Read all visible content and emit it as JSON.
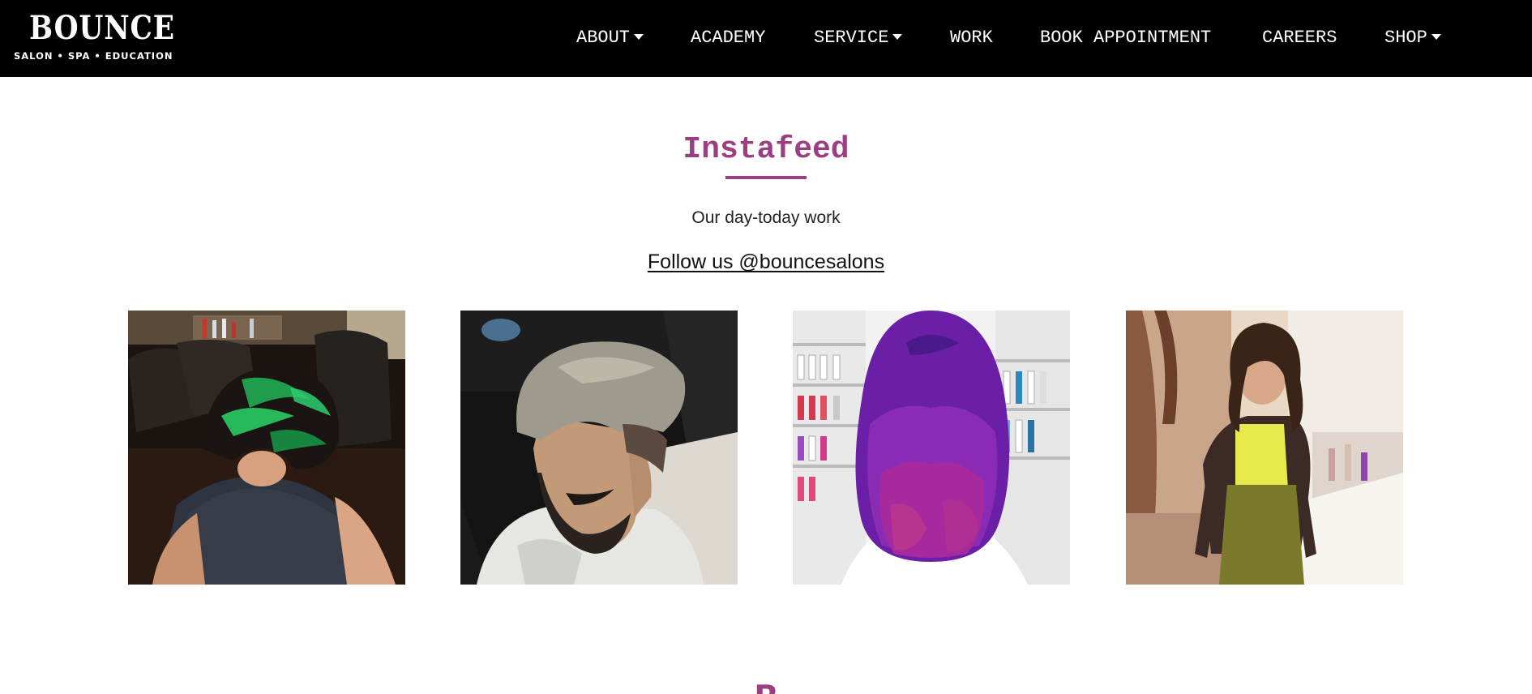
{
  "header": {
    "logo": {
      "wordmark": "BOUNCE",
      "tagline": "SALON • SPA • EDUCATION"
    },
    "nav": [
      {
        "label": "ABOUT",
        "has_dropdown": true
      },
      {
        "label": "ACADEMY",
        "has_dropdown": false
      },
      {
        "label": "SERVICE",
        "has_dropdown": true
      },
      {
        "label": "WORK",
        "has_dropdown": false
      },
      {
        "label": "BOOK APPOINTMENT",
        "has_dropdown": false
      },
      {
        "label": "CAREERS",
        "has_dropdown": false
      },
      {
        "label": "SHOP",
        "has_dropdown": true
      }
    ]
  },
  "instafeed": {
    "title": "Instafeed",
    "subtitle": "Our day-today work",
    "follow_link": "Follow us @bouncesalons",
    "photos": [
      {
        "subject": "woman with green-highlighted bob haircut in salon"
      },
      {
        "subject": "man with ash-blonde undercut and beard"
      },
      {
        "subject": "back of head with curly violet-magenta hair"
      },
      {
        "subject": "woman in yellow top and dark cardigan outside salon"
      }
    ]
  },
  "next_section": {
    "title_partial": "B"
  },
  "colors": {
    "accent": "#9c3f80",
    "header_bg": "#000000",
    "page_bg": "#ffffff"
  }
}
